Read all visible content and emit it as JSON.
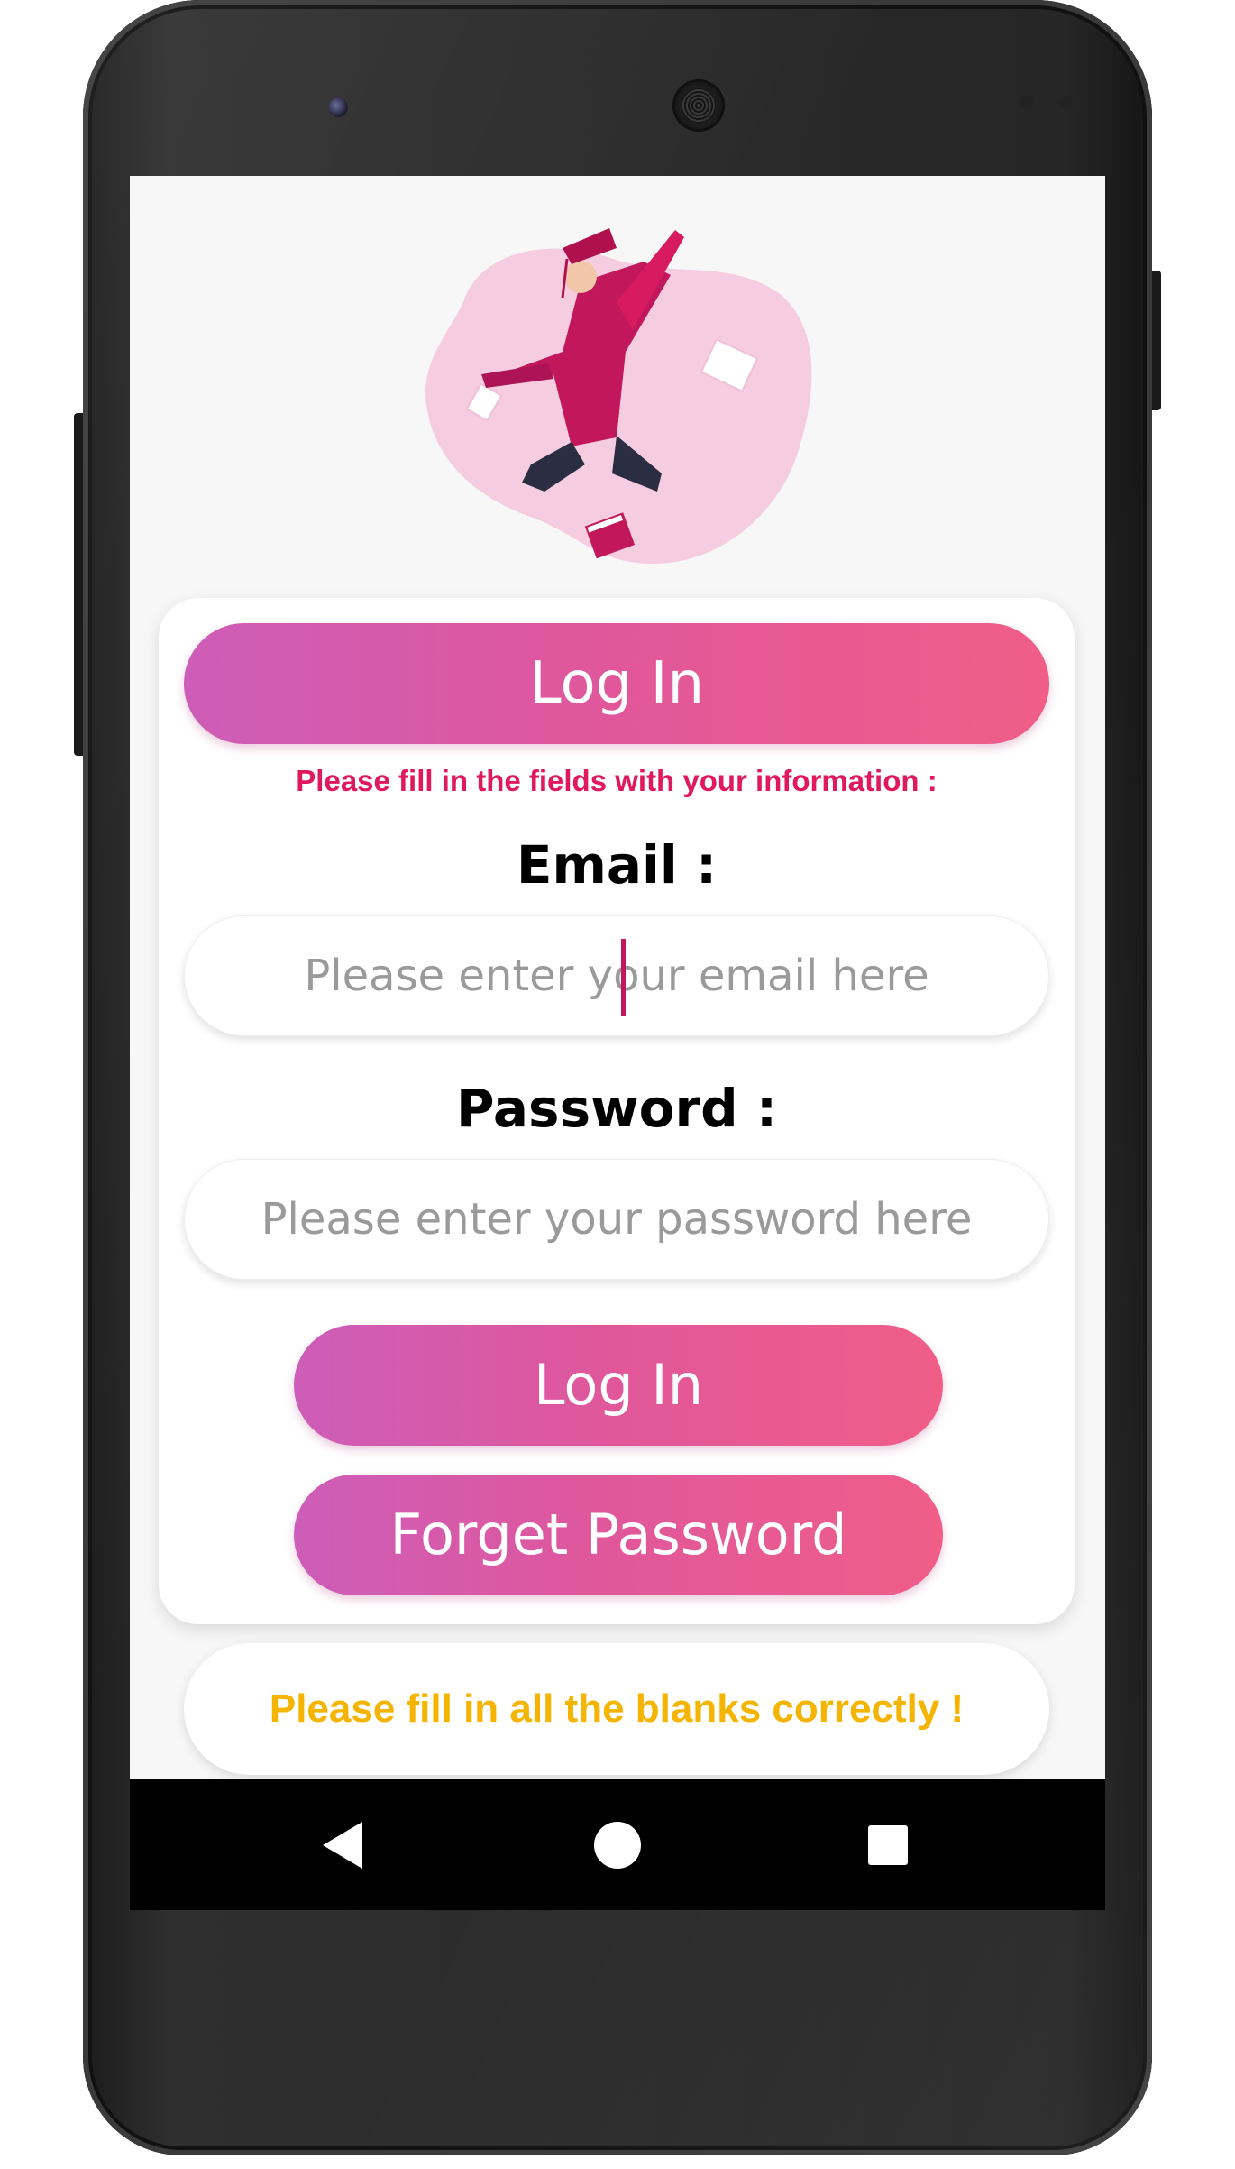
{
  "app": {
    "header_button": "Log In",
    "instruction": "Please fill in the fields with your information :",
    "email": {
      "label": "Email :",
      "placeholder": "Please enter your email here"
    },
    "password": {
      "label": "Password :",
      "placeholder": "Please enter your password here"
    },
    "login_button": "Log In",
    "forget_button": "Forget Password",
    "error_message": "Please fill in all the blanks correctly !"
  },
  "nav": {
    "back": "back-icon",
    "home": "home-icon",
    "recents": "recents-icon"
  },
  "colors": {
    "gradient_start": "#cd5db8",
    "gradient_end": "#f05e88",
    "instruction": "#e0195f",
    "error": "#f4b400",
    "caret": "#c2185b"
  }
}
